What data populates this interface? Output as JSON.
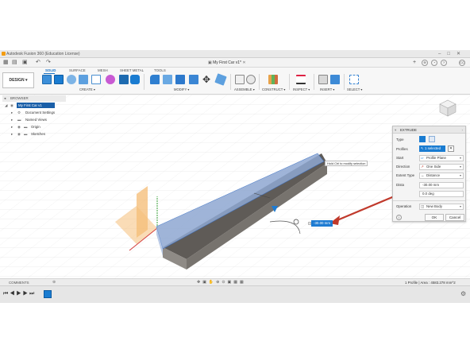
{
  "window": {
    "title": "Autodesk Fusion 360 (Education License)",
    "document_tab": "My First Car v1*",
    "user_initials": "CC"
  },
  "ribbon": {
    "tabs": [
      "SOLID",
      "SURFACE",
      "MESH",
      "SHEET METAL",
      "TOOLS"
    ],
    "active_tab": "SOLID",
    "workspace_button": "DESIGN ▾",
    "groups": [
      "CREATE ▾",
      "MODIFY ▾",
      "ASSEMBLE ▾",
      "CONSTRUCT ▾",
      "INSPECT ▾",
      "INSERT ▾",
      "SELECT ▾"
    ]
  },
  "browser": {
    "header": "BROWSER",
    "items": [
      "My First Car v1",
      "Document Settings",
      "Named Views",
      "Origin",
      "Sketches"
    ]
  },
  "extrude": {
    "title": "EXTRUDE",
    "rows": {
      "type": "Type",
      "profiles": "Profiles",
      "profiles_value": "1 selected",
      "start": "Start",
      "start_value": "Profile Plane",
      "direction": "Direction",
      "direction_value": "One Side",
      "extent_type": "Extent Type",
      "extent_value": "Distance",
      "distance": "Dista",
      "distance_value": "-30.00 mm",
      "taper_value": "0.0 deg",
      "operation": "Operation",
      "operation_value": "New Body"
    },
    "ok": "OK",
    "cancel": "Cancel"
  },
  "viewport": {
    "tooltip": "Hold Ctrl to modify selection",
    "dimension_value": "-30.00 mm"
  },
  "status": {
    "comments": "COMMENTS",
    "selection_info": "1 Profile | Area : 4583.278 mm^2"
  },
  "colors": {
    "accent": "#1a7cd1",
    "body": "#6e6a66",
    "selection": "#8fa8d2",
    "arrow": "#c0392b"
  }
}
